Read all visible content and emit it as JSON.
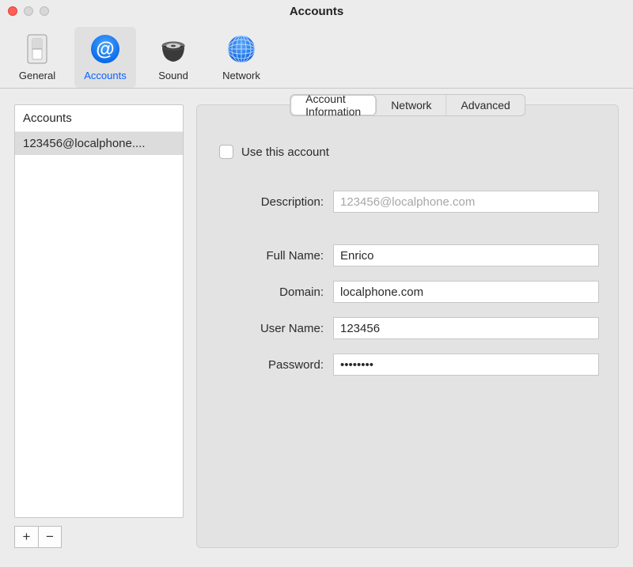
{
  "window": {
    "title": "Accounts"
  },
  "toolbar": {
    "items": [
      {
        "id": "general",
        "label": "General",
        "icon": "switch-icon",
        "selected": false
      },
      {
        "id": "accounts",
        "label": "Accounts",
        "icon": "at-icon",
        "selected": true
      },
      {
        "id": "sound",
        "label": "Sound",
        "icon": "speaker-icon",
        "selected": false
      },
      {
        "id": "network",
        "label": "Network",
        "icon": "globe-icon",
        "selected": false
      }
    ]
  },
  "sidebar": {
    "title": "Accounts",
    "items": [
      {
        "label": "123456@localphone...."
      }
    ],
    "add_label": "+",
    "remove_label": "−"
  },
  "detail": {
    "tabs": [
      {
        "label": "Account Information",
        "active": true
      },
      {
        "label": "Network",
        "active": false
      },
      {
        "label": "Advanced",
        "active": false
      }
    ],
    "use_account": {
      "label": "Use this account",
      "checked": false
    },
    "fields": {
      "description": {
        "label": "Description:",
        "value": "",
        "placeholder": "123456@localphone.com"
      },
      "full_name": {
        "label": "Full Name:",
        "value": "Enrico"
      },
      "domain": {
        "label": "Domain:",
        "value": "localphone.com"
      },
      "user_name": {
        "label": "User Name:",
        "value": "123456"
      },
      "password": {
        "label": "Password:",
        "value": "••••••••"
      }
    }
  }
}
